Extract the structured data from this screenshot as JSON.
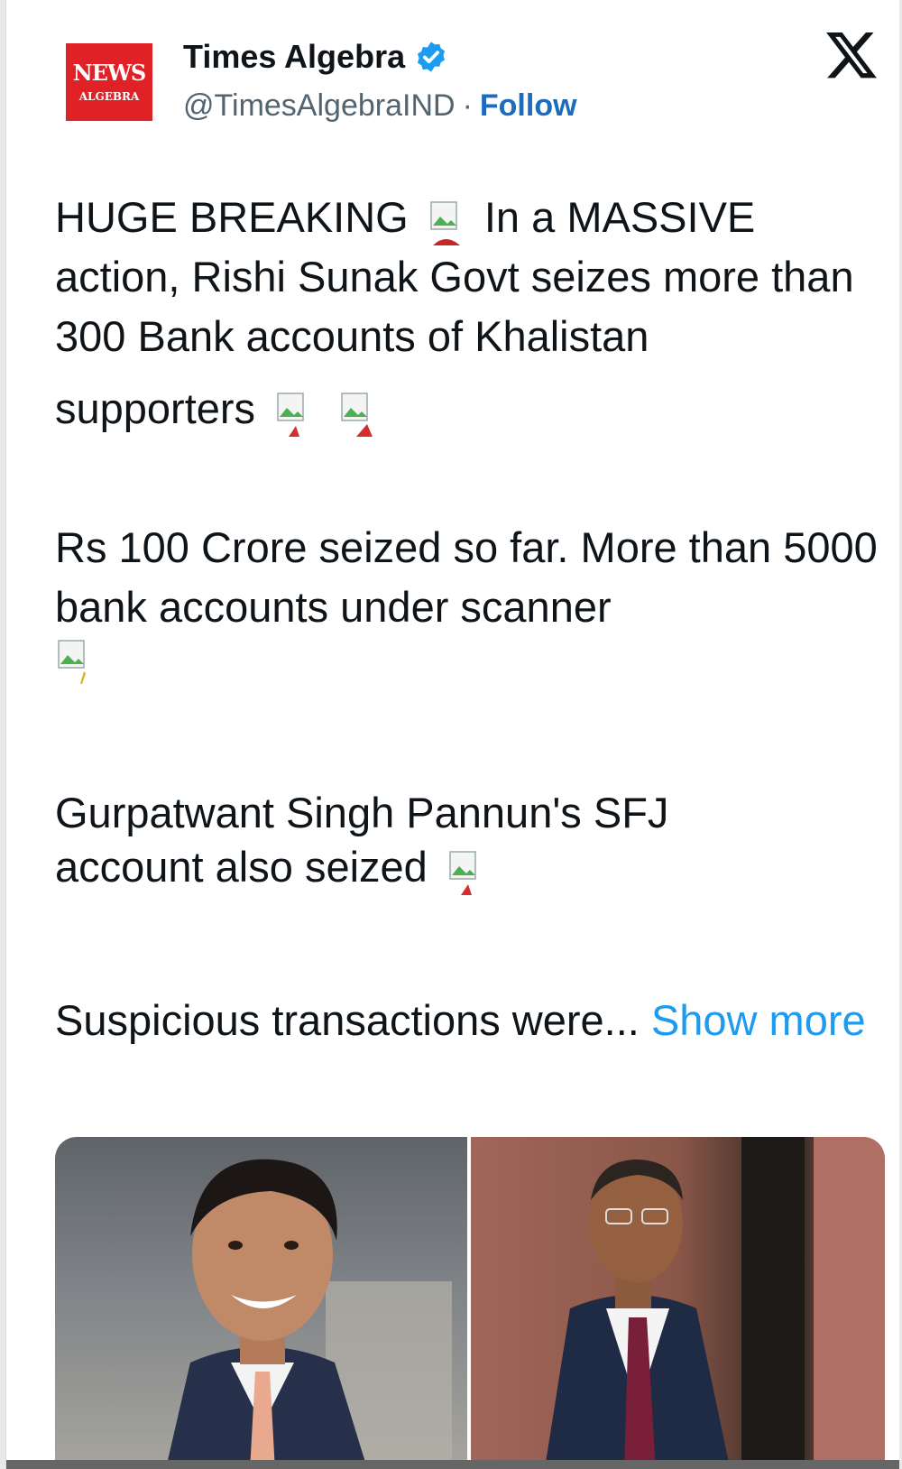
{
  "account": {
    "logo_line1": "NEWS",
    "logo_line2": "ALGEBRA",
    "name": "Times Algebra",
    "handle": "@TimesAlgebraIND",
    "separator": "·",
    "follow_label": "Follow",
    "verified_icon": "verified-badge-icon",
    "platform_icon": "x-logo-icon"
  },
  "tweet": {
    "p1_a": "HUGE BREAKING",
    "p1_b": "In a MASSIVE action, Rishi Sunak Govt seizes more than 300 Bank accounts of Khalistan",
    "p1_c": "supporters",
    "p2": "Rs 100 Crore seized so far. More than 5000 bank accounts under scanner",
    "p3_a": "Gurpatwant Singh Pannun's SFJ",
    "p3_b": "account also seized",
    "p4": "Suspicious transactions were...",
    "show_more": "Show more"
  },
  "colors": {
    "accent": "#1d9bf0",
    "follow": "#1d6bbd",
    "logo_red": "#e02126",
    "text": "#0f1419",
    "secondary": "#536471"
  }
}
